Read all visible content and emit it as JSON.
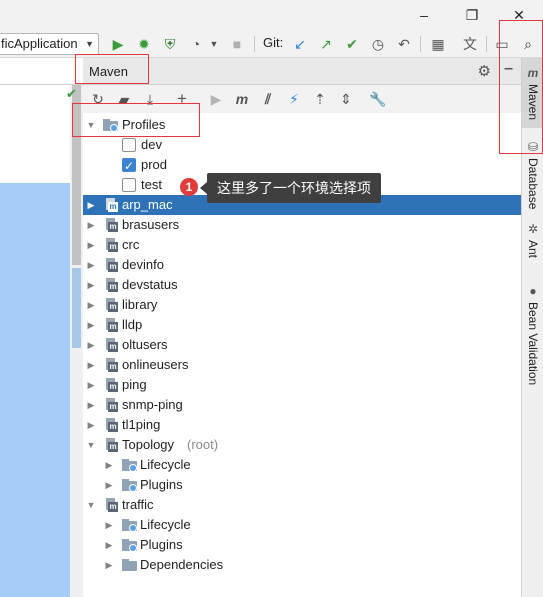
{
  "window": {
    "minimize_icon": "minimize-icon",
    "restore_icon": "restore-icon",
    "close_icon": "close-icon"
  },
  "toolbar": {
    "run_config": "ficApplication",
    "git_label": "Git:"
  },
  "maven_panel": {
    "title": "Maven"
  },
  "tree": {
    "profiles_label": "Profiles",
    "profiles": [
      {
        "label": "dev",
        "checked": false
      },
      {
        "label": "prod",
        "checked": true
      },
      {
        "label": "test",
        "checked": false
      }
    ],
    "modules": [
      {
        "label": "arp_mac",
        "selected": true
      },
      {
        "label": "brasusers"
      },
      {
        "label": "crc"
      },
      {
        "label": "devinfo"
      },
      {
        "label": "devstatus"
      },
      {
        "label": "library"
      },
      {
        "label": "lldp"
      },
      {
        "label": "oltusers"
      },
      {
        "label": "onlineusers"
      },
      {
        "label": "ping"
      },
      {
        "label": "snmp-ping"
      },
      {
        "label": "tl1ping"
      }
    ],
    "topology": {
      "label": "Topology",
      "suffix": "(root)",
      "children": [
        "Lifecycle",
        "Plugins"
      ]
    },
    "traffic": {
      "label": "traffic",
      "children": [
        "Lifecycle",
        "Plugins",
        "Dependencies"
      ]
    }
  },
  "annotation": {
    "marker": "1",
    "text": "这里多了一个环境选择项"
  },
  "sidebar": {
    "tabs": [
      {
        "label": "Maven",
        "active": true
      },
      {
        "label": "Database"
      },
      {
        "label": "Ant"
      },
      {
        "label": "Bean Validation"
      }
    ]
  },
  "colors": {
    "selection": "#2e73b8",
    "annotation_red": "#e0393b",
    "run_green": "#3a9b3a",
    "vcs_blue": "#2f86d8"
  }
}
